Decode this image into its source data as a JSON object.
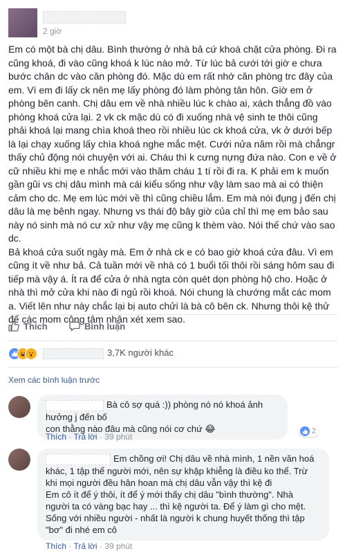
{
  "post": {
    "time": "2 giờ",
    "body_lines": [
      "Em có một bà chị dâu. Bình thường ở nhà bả cứ khoá chặt cửa phòng. Đi ra",
      "cũng khoá, đi vào cũng khoá k lúc nào    mở. Từ lúc bả cưới tới giờ e chưa",
      "bước chân dc vào căn phòng đó. Mặc dù em rất nhớ căn phòng trc đây của",
      "em. Vì em đi lấy ck nên mẹ lấy phòng đó làm phòng tân hôn. Giờ em ở",
      "phòng bên canh. Chị dâu em về nhà nhiều lúc k chào ai, xách thẳng đồ vào",
      "phòng khoá cửa lại. 2 vk ck mặc dù có đi xuống nhà vệ sinh te thôi cũng",
      "phải khoá lại mang chìa khoá theo rồi nhiều lúc ck khoá cửa, vk ở dưới bếp",
      "là lại chạy xuống lấy chìa khoá nghe mắc mệt. Cưới nửa năm rồi mà chẳngr",
      "thấy chủ động nói chuyện với ai. Cháu thì k cưng nựng đứa nào. Con e về ở",
      "cữ nhiều khi mẹ e nhắc mới vào thăm cháu 1 tí rồi đi ra. K phải em k muốn",
      "gần gũi vs chị dâu mình mà cái kiểu sống như vậy làm sao mà ai có thiện",
      "cảm cho dc. Mẹ em lúc mới về thì cũng chiều lắm. Em mà nói đụng j đến chị",
      "dâu là mẹ bênh ngay. Nhưng vs thái độ bây giờ của chỉ thì mẹ em bảo sau",
      "này nó sinh mà nó cư xử như vậy mẹ cũng k thèm vào. Nói thế chứ vào sao dc.",
      "Bả khoá cửa suốt ngày mà. Em ở nhà ck e có bao giờ khoá cửa đâu. Vì em",
      "cũng ít về như bả. Cả tuần mới về nhà có 1 buổi tối thôi rồi sáng hôm sau đi",
      "tiếp mà vậy á. Ít ra để cửa ở nhà ngta còn quét dọn phòng hộ cho. Hoặc ở",
      "nhà thì mở cửa khi nào đi ngủ rồi khoá. Nói chung là chướng mắt các mom",
      "a. Viết lên như này chắc lại bị auto chửi là bà cô bên ck. Nhưng thôi kệ thử",
      "để các mom công tâm nhận xét xem sao."
    ]
  },
  "actions": {
    "like_label": "Thích",
    "comment_label": "Bình luận"
  },
  "reactions": {
    "count_text": "3,7K người khác"
  },
  "comments_section": {
    "view_previous": "Xem các bình luận trước"
  },
  "comments": [
    {
      "text_lines": [
        "Bà cô sợ quá :)) phòng nó nó khoá ảnh hưởng j đến bố",
        "con thằng nào đâu mà cũng nói cơ chứ 😂"
      ],
      "like": "Thích",
      "reply": "Trả lời",
      "time": "39 phút",
      "reaction_count": "2"
    },
    {
      "text_lines": [
        "Em chồng ơi! Chị dâu về nhà mình, 1 nền văn hoá",
        "khác, 1 tập thể người mới, nên sự khập khiễng là điều ko thể. Trừ",
        "khi mọi người đều hân hoan mà chị dâu vẫn vậy thì kệ đi",
        "Em cô ít để ý thôi, ít để ý mới thấy chị dâu \"bình thường\". Nhà",
        "người ta có vàng bạc hay ... thì kệ người ta. Để ý làm gì cho mệt.",
        "Sống với nhiều người - nhất là người k chung huyết thống thì tập",
        "\"bơ\" đi nhé em cô"
      ],
      "like": "Thích",
      "reply": "Trả lời",
      "time": "39 phút"
    }
  ],
  "colors": {
    "link": "#365899",
    "muted": "#90949c",
    "bubble": "#f2f3f5",
    "like_blue": "#5890ff",
    "laugh_yellow": "#f7b125"
  }
}
